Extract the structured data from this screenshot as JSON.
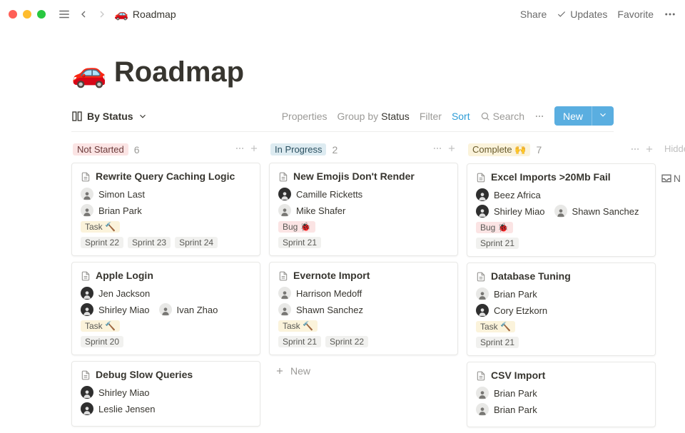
{
  "breadcrumb": {
    "emoji": "🚗",
    "title": "Roadmap"
  },
  "topbar": {
    "share": "Share",
    "updates": "Updates",
    "favorite": "Favorite"
  },
  "page": {
    "emoji": "🚗",
    "title": "Roadmap"
  },
  "view": {
    "selector": "By Status",
    "properties": "Properties",
    "group_by_prefix": "Group by ",
    "group_by_value": "Status",
    "filter": "Filter",
    "sort": "Sort",
    "search": "Search",
    "new": "New"
  },
  "hidden_label": "Hidde",
  "inbox_label": "N",
  "new_card_label": "New",
  "columns": [
    {
      "id": "not_started",
      "label": "Not Started",
      "count": "6",
      "pill_class": "pill-red",
      "cards": [
        {
          "title": "Rewrite Query Caching Logic",
          "people": [
            {
              "name": "Simon Last",
              "dark": false
            },
            {
              "name": "Brian Park",
              "dark": false
            }
          ],
          "type_tag": {
            "label": "Task 🔨",
            "cls": "tag-task"
          },
          "sprints": [
            "Sprint 22",
            "Sprint 23",
            "Sprint 24"
          ]
        },
        {
          "title": "Apple Login",
          "people": [
            {
              "name": "Jen Jackson",
              "dark": true
            },
            {
              "name": "Shirley Miao",
              "dark": true
            },
            {
              "name": "Ivan Zhao",
              "dark": false
            }
          ],
          "people_layout": "two-one",
          "type_tag": {
            "label": "Task 🔨",
            "cls": "tag-task"
          },
          "sprints": [
            "Sprint 20"
          ]
        },
        {
          "title": "Debug Slow Queries",
          "people": [
            {
              "name": "Shirley Miao",
              "dark": true
            },
            {
              "name": "Leslie Jensen",
              "dark": true
            }
          ]
        }
      ]
    },
    {
      "id": "in_progress",
      "label": "In Progress",
      "count": "2",
      "pill_class": "pill-blue",
      "cards": [
        {
          "title": "New Emojis Don't Render",
          "people": [
            {
              "name": "Camille Ricketts",
              "dark": true
            },
            {
              "name": "Mike Shafer",
              "dark": false
            }
          ],
          "type_tag": {
            "label": "Bug 🐞",
            "cls": "tag-bug"
          },
          "sprints": [
            "Sprint 21"
          ]
        },
        {
          "title": "Evernote Import",
          "people": [
            {
              "name": "Harrison Medoff",
              "dark": false
            },
            {
              "name": "Shawn Sanchez",
              "dark": false
            }
          ],
          "type_tag": {
            "label": "Task 🔨",
            "cls": "tag-task"
          },
          "sprints": [
            "Sprint 21",
            "Sprint 22"
          ]
        }
      ],
      "show_new": true
    },
    {
      "id": "complete",
      "label": "Complete 🙌",
      "count": "7",
      "pill_class": "pill-yellow",
      "cards": [
        {
          "title": "Excel Imports >20Mb Fail",
          "people": [
            {
              "name": "Beez Africa",
              "dark": true
            },
            {
              "name": "Shirley Miao",
              "dark": true
            },
            {
              "name": "Shawn Sanchez",
              "dark": false
            }
          ],
          "people_layout": "one-two",
          "type_tag": {
            "label": "Bug 🐞",
            "cls": "tag-bug"
          },
          "sprints": [
            "Sprint 21"
          ]
        },
        {
          "title": "Database Tuning",
          "people": [
            {
              "name": "Brian Park",
              "dark": false
            },
            {
              "name": "Cory Etzkorn",
              "dark": true
            }
          ],
          "type_tag": {
            "label": "Task 🔨",
            "cls": "tag-task"
          },
          "sprints": [
            "Sprint 21"
          ]
        },
        {
          "title": "CSV Import",
          "people": [
            {
              "name": "Brian Park",
              "dark": false
            },
            {
              "name": "Brian Park",
              "dark": false
            }
          ]
        }
      ]
    }
  ]
}
